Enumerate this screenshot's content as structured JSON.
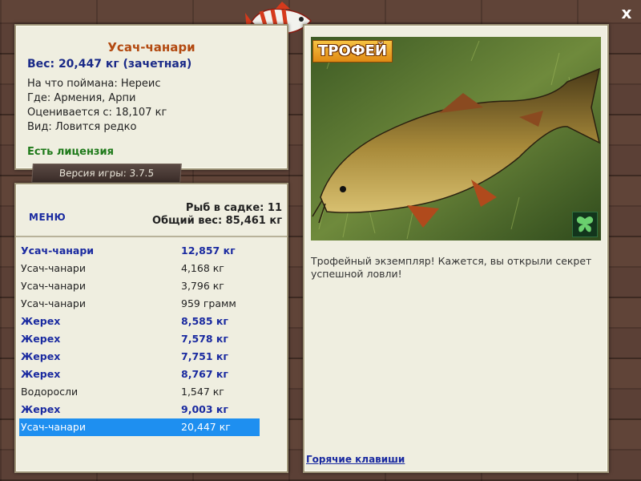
{
  "info": {
    "fish_name": "Усач-чанари",
    "weight_line": "Вес: 20,447 кг (зачетная)",
    "bait_line": "На что поймана: Нереис",
    "location_line": "Где: Армения, Арпи",
    "value_line": "Оценивается с: 18,107 кг",
    "rarity_line": "Вид: Ловится редко",
    "license": "Есть лицензия"
  },
  "version": "Версия игры: 3.7.5",
  "menu_label": "МЕНЮ",
  "stats": {
    "fish_count": "Рыб в садке: 11",
    "total_weight": "Общий вес: 85,461 кг"
  },
  "catch_list": [
    {
      "name": "Усач-чанари",
      "weight": "12,857 кг",
      "trophy": true
    },
    {
      "name": "Усач-чанари",
      "weight": "4,168 кг",
      "trophy": false
    },
    {
      "name": "Усач-чанари",
      "weight": "3,796 кг",
      "trophy": false
    },
    {
      "name": "Усач-чанари",
      "weight": "959 грамм",
      "trophy": false
    },
    {
      "name": "Жерех",
      "weight": "8,585 кг",
      "trophy": true
    },
    {
      "name": "Жерех",
      "weight": "7,578 кг",
      "trophy": true
    },
    {
      "name": "Жерех",
      "weight": "7,751 кг",
      "trophy": true
    },
    {
      "name": "Жерех",
      "weight": "8,767 кг",
      "trophy": true
    },
    {
      "name": "Водоросли",
      "weight": "1,547 кг",
      "trophy": false
    },
    {
      "name": "Жерех",
      "weight": "9,003 кг",
      "trophy": true
    },
    {
      "name": "Усач-чанари",
      "weight": "20,447 кг",
      "trophy": false,
      "selected": true
    }
  ],
  "detail": {
    "badge": "ТРОФЕЙ",
    "description": "Трофейный экземпляр! Кажется, вы открыли секрет успешной ловли!",
    "hotkeys": "Горячие клавиши"
  },
  "close_label": "x",
  "colors": {
    "accent_title": "#b34a11",
    "trophy_blue": "#1a2aa0",
    "license_green": "#1f7a1a",
    "selection": "#1e8ff0"
  }
}
